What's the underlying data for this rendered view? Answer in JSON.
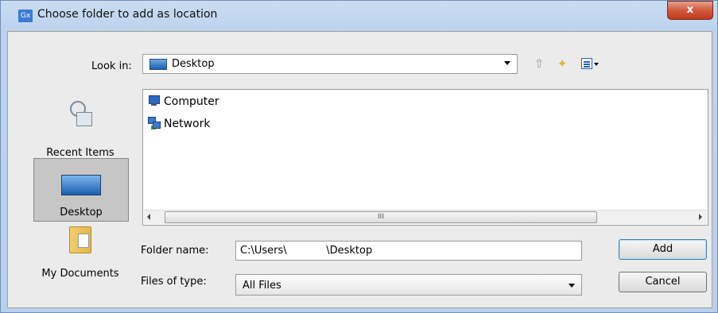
{
  "window": {
    "app_icon_text": "Gx",
    "title": "Choose folder to add as location",
    "close_glyph": "x"
  },
  "toolbar": {
    "lookin_label": "Look in:",
    "lookin_value": "Desktop",
    "icons": [
      "up-one-level-icon",
      "create-new-folder-icon",
      "view-menu-icon"
    ]
  },
  "places": [
    {
      "label": "Recent Items",
      "icon": "recent-items-icon"
    },
    {
      "label": "Desktop",
      "icon": "desktop-icon",
      "selected": true
    },
    {
      "label": "My Documents",
      "icon": "my-documents-icon"
    }
  ],
  "files": [
    {
      "name": "Computer",
      "icon": "computer-icon"
    },
    {
      "name": "Network",
      "icon": "network-icon"
    }
  ],
  "scrollbar": {
    "thumb_grip": "III"
  },
  "form": {
    "folder_name_label": "Folder name:",
    "folder_name_value": "C:\\Users\\            \\Desktop",
    "files_of_type_label": "Files of type:",
    "files_of_type_value": "All Files"
  },
  "buttons": {
    "add": "Add",
    "cancel": "Cancel"
  }
}
